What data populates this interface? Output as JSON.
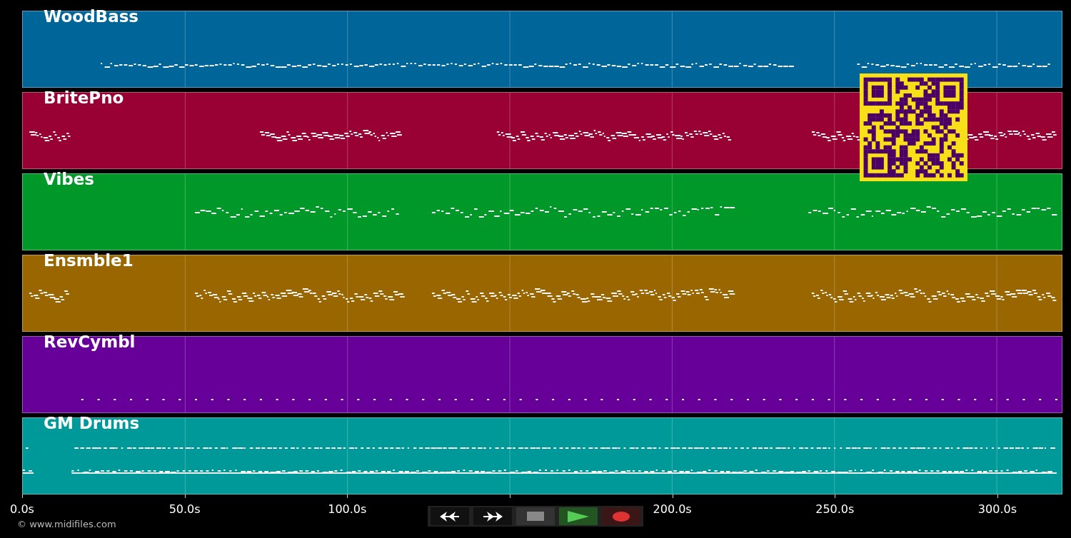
{
  "tracks": [
    {
      "name": "WoodBass",
      "color": "#006699"
    },
    {
      "name": "BritePno",
      "color": "#990033"
    },
    {
      "name": "Vibes",
      "color": "#009929"
    },
    {
      "name": "Ensmble1",
      "color": "#996600"
    },
    {
      "name": "RevCymbl",
      "color": "#660099"
    },
    {
      "name": "GM Drums",
      "color": "#009999"
    }
  ],
  "axis": {
    "ticks": [
      {
        "kind": "labeled",
        "label": "0.0s"
      },
      {
        "kind": "labeled",
        "label": "50.0s"
      },
      {
        "kind": "labeled",
        "label": "100.0s"
      },
      {
        "kind": "covered"
      },
      {
        "kind": "labeled",
        "label": "200.0s"
      },
      {
        "kind": "labeled",
        "label": "250.0s"
      },
      {
        "kind": "labeled",
        "label": "300.0s"
      }
    ]
  },
  "copyright": "© www.midifiles.com",
  "transport": [
    {
      "kind": "rewind"
    },
    {
      "kind": "forward"
    },
    {
      "kind": "stop"
    },
    {
      "kind": "play"
    },
    {
      "kind": "record"
    }
  ]
}
